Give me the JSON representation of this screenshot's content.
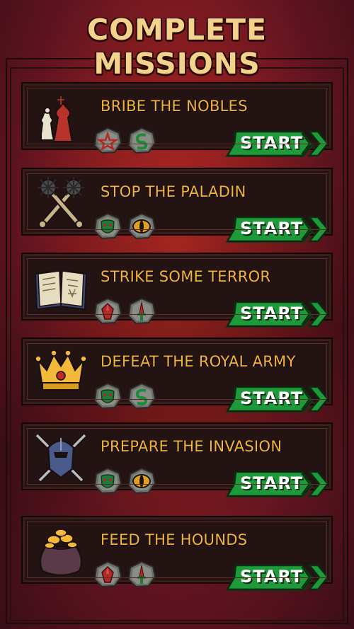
{
  "header": {
    "title": "COMPLETE MISSIONS"
  },
  "missions": [
    {
      "title": "BRIBE THE NOBLES",
      "icon": "chess-pieces-icon",
      "requirements": [
        "pentagram-token-icon",
        "serpent-token-icon"
      ],
      "start_label": "START"
    },
    {
      "title": "STOP THE PALADIN",
      "icon": "crossed-maces-icon",
      "requirements": [
        "orc-mask-token-icon",
        "evil-eye-token-icon"
      ],
      "start_label": "START"
    },
    {
      "title": "STRIKE SOME TERROR",
      "icon": "spell-book-icon",
      "requirements": [
        "blood-gem-token-icon",
        "dagger-token-icon"
      ],
      "start_label": "START"
    },
    {
      "title": "DEFEAT THE ROYAL ARMY",
      "icon": "gold-crown-icon",
      "requirements": [
        "orc-mask-token-icon",
        "serpent-token-icon"
      ],
      "start_label": "START"
    },
    {
      "title": "PREPARE THE INVASION",
      "icon": "knight-helmet-swords-icon",
      "requirements": [
        "orc-mask-token-icon",
        "evil-eye-token-icon"
      ],
      "start_label": "START"
    },
    {
      "title": "FEED THE HOUNDS",
      "icon": "gold-sack-icon",
      "requirements": [
        "blood-gem-token-icon",
        "dagger-token-icon"
      ],
      "start_label": "START"
    }
  ],
  "colors": {
    "title_gold": "#f3d38c",
    "mission_text": "#f2b43a",
    "start_green": "#1f9a3a",
    "panel": "#231313"
  }
}
